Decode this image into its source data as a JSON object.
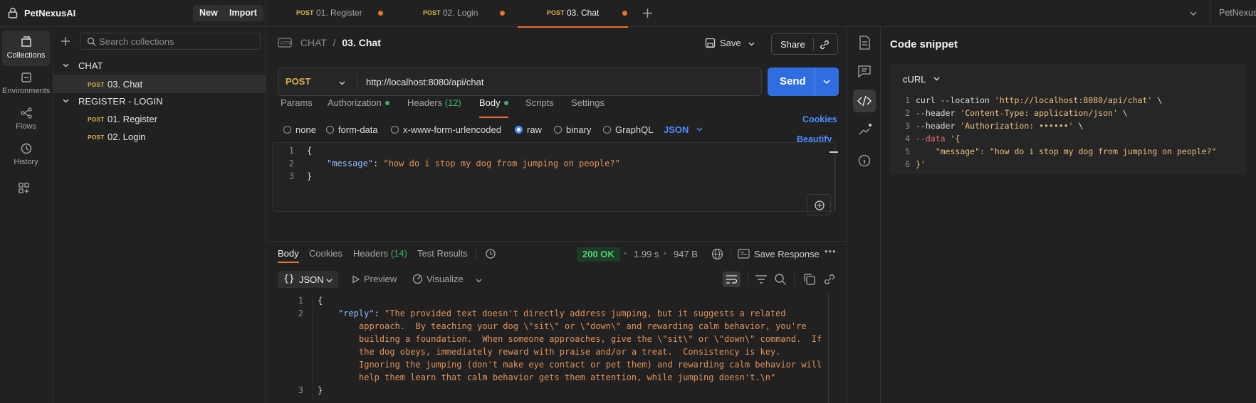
{
  "workspace": {
    "name": "PetNexusAI",
    "new_label": "New",
    "import_label": "Import"
  },
  "tabs": [
    {
      "method": "POST",
      "name": "01. Register"
    },
    {
      "method": "POST",
      "name": "02. Login"
    },
    {
      "method": "POST",
      "name": "03. Chat"
    }
  ],
  "top_right_label": "PetNexus",
  "nav": [
    "Collections",
    "Environments",
    "Flows",
    "History"
  ],
  "collections": {
    "search_placeholder": "Search collections",
    "folders": [
      {
        "name": "CHAT",
        "items": [
          {
            "method": "POST",
            "name": "03. Chat"
          }
        ]
      },
      {
        "name": "REGISTER - LOGIN",
        "items": [
          {
            "method": "POST",
            "name": "01. Register"
          },
          {
            "method": "POST",
            "name": "02. Login"
          }
        ]
      }
    ]
  },
  "request": {
    "breadcrumb": {
      "parent": "CHAT",
      "sep": "/",
      "current": "03. Chat"
    },
    "save_label": "Save",
    "share_label": "Share",
    "method": "POST",
    "url": "http://localhost:8080/api/chat",
    "send_label": "Send",
    "tabs": {
      "params": "Params",
      "authorization": "Authorization",
      "headers": "Headers",
      "headers_count": "(12)",
      "body": "Body",
      "scripts": "Scripts",
      "settings": "Settings"
    },
    "cookies_label": "Cookies",
    "beautify_label": "Beautify",
    "body_types": [
      "none",
      "form-data",
      "x-www-form-urlencoded",
      "raw",
      "binary",
      "GraphQL"
    ],
    "body_format": "JSON",
    "body_lines": [
      "{",
      "\"message\"",
      ": ",
      "\"how do i stop my dog from jumping on people?\"",
      "}"
    ]
  },
  "response": {
    "tabs": {
      "body": "Body",
      "cookies": "Cookies",
      "headers": "Headers",
      "headers_count": "(14)",
      "tests": "Test Results"
    },
    "status": "200 OK",
    "time": "1.99 s",
    "size": "947 B",
    "save_label": "Save Response",
    "format": "JSON",
    "preview_label": "Preview",
    "visualize_label": "Visualize",
    "reply_key": "\"reply\"",
    "reply_lines": [
      "\"The provided text doesn't directly address jumping, but it suggests a related",
      "approach.  By teaching your dog \\\"sit\\\" or \\\"down\\\" and rewarding calm behavior, you're",
      "building a foundation.  When someone approaches, give the \\\"sit\\\" or \\\"down\\\" command.  If",
      "the dog obeys, immediately reward with praise and/or a treat.  Consistency is key.",
      "Ignoring the jumping (don't make eye contact or pet them) and rewarding calm behavior will",
      "help them learn that calm behavior gets them attention, while jumping doesn't.\\n\""
    ]
  },
  "snippet": {
    "title": "Code snippet",
    "language": "cURL",
    "lines": [
      {
        "n": "1",
        "a": "curl --location ",
        "b": "'http://localhost:8080/api/chat'",
        "c": " \\"
      },
      {
        "n": "2",
        "a": "--header ",
        "b": "'Content-Type: application/json'",
        "c": " \\"
      },
      {
        "n": "3",
        "a": "--header ",
        "b": "'Authorization: ••••••'",
        "c": " \\"
      },
      {
        "n": "4",
        "a": "--data ",
        "b": "'{",
        "c": ""
      },
      {
        "n": "5",
        "a": "    ",
        "b": "\"message\": \"how do i stop my dog from jumping on people?\"",
        "c": ""
      },
      {
        "n": "6",
        "a": "",
        "b": "}'",
        "c": ""
      }
    ]
  },
  "colors": {
    "accent": "#e8732a",
    "send": "#2f6ee0",
    "post": "#d8b24a",
    "ok": "#4fd07a",
    "link": "#4a8dff"
  }
}
